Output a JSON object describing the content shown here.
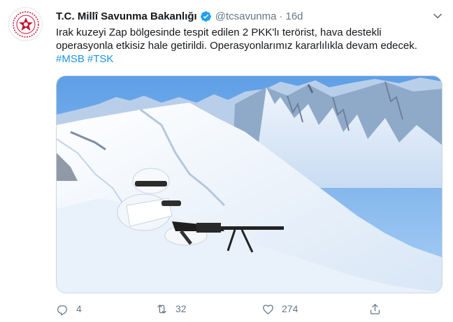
{
  "account": {
    "name": "T.C. Millî Savunma Bakanlığı",
    "handle": "@tcsavunma",
    "separator": "·",
    "time": "16d"
  },
  "tweet": {
    "line1": "Irak kuzeyi Zap bölgesinde tespit edilen 2 PKK'lı terörist, hava destekli",
    "line2": "operasyonla etkisiz hale getirildi. Operasyonlarımız kararlılıkla devam edecek.",
    "hashtags": [
      "#MSB",
      "#TSK"
    ]
  },
  "actions": {
    "reply_count": "4",
    "retweet_count": "32",
    "like_count": "274"
  },
  "colors": {
    "link": "#1b95e0",
    "muted": "#657786",
    "text": "#14171a",
    "verified": "#1da1f2",
    "emblem": "#c8102e"
  },
  "icons": [
    "emblem-logo",
    "verified-badge-icon",
    "chevron-down-icon",
    "reply-icon",
    "retweet-icon",
    "like-icon",
    "share-icon"
  ]
}
